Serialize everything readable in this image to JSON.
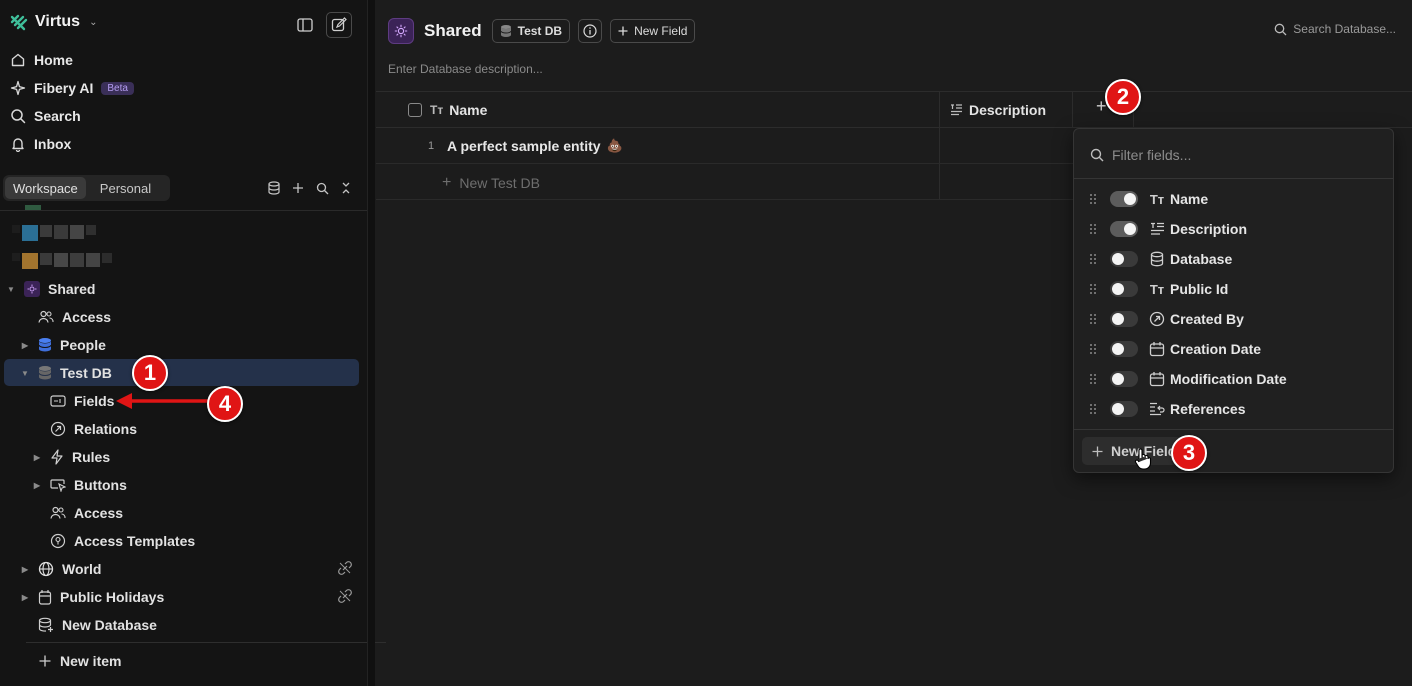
{
  "sidebar": {
    "workspace_name": "Virtus",
    "nav": {
      "home": "Home",
      "fibery_ai": "Fibery AI",
      "beta": "Beta",
      "search": "Search",
      "inbox": "Inbox"
    },
    "tabs": {
      "workspace": "Workspace",
      "personal": "Personal"
    },
    "tree": {
      "shared": "Shared",
      "access": "Access",
      "people": "People",
      "test_db": "Test DB",
      "fields": "Fields",
      "relations": "Relations",
      "rules": "Rules",
      "buttons": "Buttons",
      "access2": "Access",
      "access_templates": "Access Templates",
      "world": "World",
      "public_holidays": "Public Holidays",
      "new_database": "New Database",
      "new_item": "New item"
    }
  },
  "header": {
    "title": "Shared",
    "db_chip": "Test DB",
    "new_field": "New Field",
    "search_placeholder": "Search Database...",
    "description_placeholder": "Enter Database description..."
  },
  "table": {
    "columns": {
      "name": "Name",
      "description": "Description"
    },
    "rows": [
      {
        "num": "1",
        "name": "A perfect sample entity",
        "emoji": "💩"
      }
    ],
    "new_row": "New Test DB"
  },
  "dropdown": {
    "filter_placeholder": "Filter fields...",
    "fields": [
      {
        "label": "Name",
        "on": true,
        "icon": "text-type-icon"
      },
      {
        "label": "Description",
        "on": true,
        "icon": "rich-text-icon"
      },
      {
        "label": "Database",
        "on": false,
        "icon": "database-icon"
      },
      {
        "label": "Public Id",
        "on": false,
        "icon": "text-type-icon"
      },
      {
        "label": "Created By",
        "on": false,
        "icon": "relation-icon"
      },
      {
        "label": "Creation Date",
        "on": false,
        "icon": "calendar-icon"
      },
      {
        "label": "Modification Date",
        "on": false,
        "icon": "calendar-icon"
      },
      {
        "label": "References",
        "on": false,
        "icon": "references-icon"
      }
    ],
    "new_field": "New Field"
  },
  "annotations": {
    "b1": "1",
    "b2": "2",
    "b3": "3",
    "b4": "4",
    "color": "#e01515"
  }
}
